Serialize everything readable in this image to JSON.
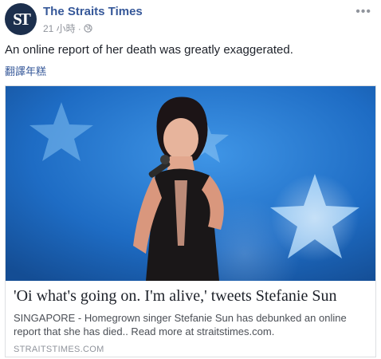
{
  "post": {
    "page_name": "The Straits Times",
    "avatar_text": "ST",
    "timestamp": "21 小時",
    "separator": "·",
    "privacy_icon": "globe-icon",
    "more_icon": "ellipsis-icon",
    "more_label": "•••",
    "text": "An online report of her death was greatly exaggerated.",
    "translate_label": "翻譯年糕"
  },
  "link_card": {
    "title": "'Oi what's going on. I'm alive,' tweets Stefanie Sun",
    "description": "SINGAPORE - Homegrown singer Stefanie Sun has debunked an online report that she has died.. Read more at straitstimes.com.",
    "domain": "STRAITSTIMES.COM"
  },
  "colors": {
    "link_blue": "#365899",
    "avatar_bg": "#1c2f4d",
    "muted": "#90949c",
    "border": "#dddfe2"
  }
}
